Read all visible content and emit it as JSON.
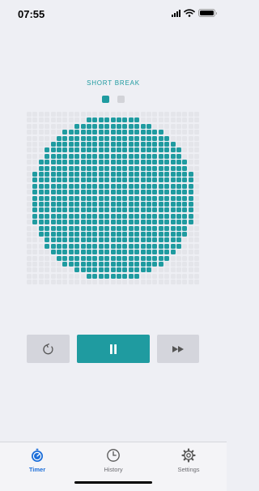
{
  "status_bar": {
    "time": "07:55",
    "battery_level": 1.0
  },
  "timer": {
    "mode_label": "SHORT BREAK",
    "sessions": [
      {
        "completed": true
      },
      {
        "completed": false
      }
    ],
    "remaining_fraction": 0.72
  },
  "controls": {
    "reset_icon": "reset-icon",
    "pause_icon": "pause-icon",
    "skip_icon": "skip-forward-icon"
  },
  "tabs": [
    {
      "label": "Timer",
      "icon": "stopwatch-icon",
      "active": true
    },
    {
      "label": "History",
      "icon": "clock-icon",
      "active": false
    },
    {
      "label": "Settings",
      "icon": "gear-icon",
      "active": false
    }
  ],
  "colors": {
    "accent": "#1f9ba0",
    "tab_active": "#1e6fd9",
    "cell_off": "#e4e5ea",
    "button_secondary": "#d4d5dc",
    "background": "#eeeff4"
  }
}
